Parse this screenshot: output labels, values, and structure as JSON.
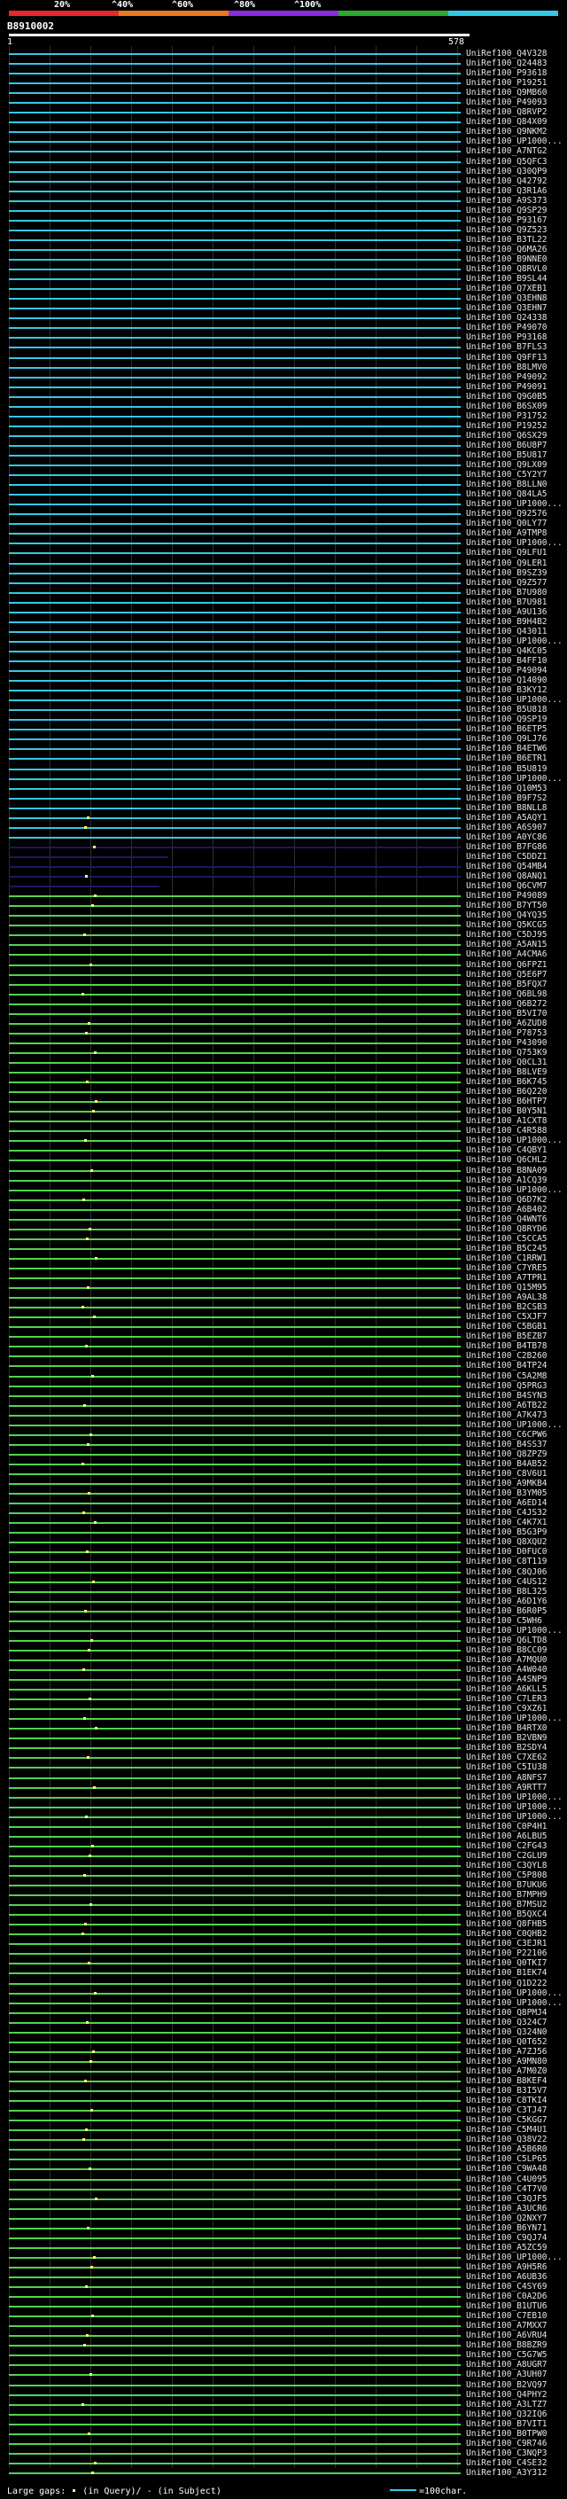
{
  "query_id": "B8910002",
  "scale": {
    "start": "1",
    "end": "578"
  },
  "identity_bar": {
    "labels": [
      "20%",
      "^40%",
      "^60%",
      "^80%",
      "^100%"
    ],
    "colors": [
      "#e8272f",
      "#e87b1e",
      "#8a2be2",
      "#2eaa2e",
      "#33c9e6"
    ]
  },
  "colors": {
    "high": "#33c9e6",
    "mid": "#4fd54f",
    "low": "#1a1a60",
    "gap": "#ffff66",
    "text": "#e6e6e6"
  },
  "legend": {
    "text": "Large gaps:",
    "in_query": "(in Query)/",
    "in_subject": "- (in Subject)",
    "scale": "=100char."
  },
  "subjects": [
    "UniRef100_Q4V328",
    "UniRef100_Q24483",
    "UniRef100_P93618",
    "UniRef100_P19251",
    "UniRef100_Q9MB60",
    "UniRef100_P49093",
    "UniRef100_Q8RVP2",
    "UniRef100_Q84X09",
    "UniRef100_Q9NKM2",
    "UniRef100_UP1000...",
    "UniRef100_A7NTG2",
    "UniRef100_Q5QFC3",
    "UniRef100_Q30QP9",
    "UniRef100_Q42792",
    "UniRef100_Q3R1A6",
    "UniRef100_A9S373",
    "UniRef100_Q9SP29",
    "UniRef100_P93167",
    "UniRef100_Q9Z523",
    "UniRef100_B3TL22",
    "UniRef100_Q6MA26",
    "UniRef100_B9NNE0",
    "UniRef100_Q8RVL0",
    "UniRef100_B9SL44",
    "UniRef100_Q7XEB1",
    "UniRef100_Q3EHN8",
    "UniRef100_Q3EHN7",
    "UniRef100_Q24338",
    "UniRef100_P49070",
    "UniRef100_P93168",
    "UniRef100_B7FLS3",
    "UniRef100_Q9FF13",
    "UniRef100_B8LMV0",
    "UniRef100_P49092",
    "UniRef100_P49091",
    "UniRef100_Q9G0B5",
    "UniRef100_B6SX09",
    "UniRef100_P31752",
    "UniRef100_P19252",
    "UniRef100_Q6SX29",
    "UniRef100_B6U8P7",
    "UniRef100_B5U817",
    "UniRef100_Q9LX09",
    "UniRef100_C5Y2Y7",
    "UniRef100_B8LLN0",
    "UniRef100_Q84LA5",
    "UniRef100_UP1000...",
    "UniRef100_Q92576",
    "UniRef100_Q0LY77",
    "UniRef100_A9TMP8",
    "UniRef100_UP1000...",
    "UniRef100_Q9LFU1",
    "UniRef100_Q9LER1",
    "UniRef100_B9SZ39",
    "UniRef100_Q9Z577",
    "UniRef100_B7U980",
    "UniRef100_B7U981",
    "UniRef100_A9U136",
    "UniRef100_B9H4B2",
    "UniRef100_Q43011",
    "UniRef100_UP1000...",
    "UniRef100_Q4KC05",
    "UniRef100_B4FF10",
    "UniRef100_P49094",
    "UniRef100_Q14090",
    "UniRef100_B3KY12",
    "UniRef100_UP1000...",
    "UniRef100_B5U818",
    "UniRef100_Q9SP19",
    "UniRef100_B6ETP5",
    "UniRef100_Q9LJ76",
    "UniRef100_B4ETW6",
    "UniRef100_B6ETR1",
    "UniRef100_B5U819",
    "UniRef100_UP1000...",
    "UniRef100_Q10M53",
    "UniRef100_B9F7S2",
    "UniRef100_B8NLL8",
    "UniRef100_A5AQY1",
    "UniRef100_A6S907",
    "UniRef100_A0YC86",
    "UniRef100_B7FG86",
    "UniRef100_C5DDZ1",
    "UniRef100_Q54MB4",
    "UniRef100_Q8ANQ1",
    "UniRef100_Q6CVM7",
    "UniRef100_P49089",
    "UniRef100_B7YT50",
    "UniRef100_Q4YQ35",
    "UniRef100_Q5KCG5",
    "UniRef100_C5DJ95",
    "UniRef100_A5AN15",
    "UniRef100_A4CMA6",
    "UniRef100_Q6FPZ1",
    "UniRef100_Q5E6P7",
    "UniRef100_B5FQX7",
    "UniRef100_Q6BL98",
    "UniRef100_Q6B272",
    "UniRef100_B5VI70",
    "UniRef100_A6ZUD8",
    "UniRef100_P78753",
    "UniRef100_P43090",
    "UniRef100_Q753K9",
    "UniRef100_Q0CL31",
    "UniRef100_B8LVE9",
    "UniRef100_B6K745",
    "UniRef100_B6Q220",
    "UniRef100_B6HTP7",
    "UniRef100_B0Y5N1",
    "UniRef100_A1CXT8",
    "UniRef100_C4R588",
    "UniRef100_UP1000...",
    "UniRef100_C4QBY1",
    "UniRef100_Q6CHL2",
    "UniRef100_B8NA09",
    "UniRef100_A1CQ39",
    "UniRef100_UP1000...",
    "UniRef100_Q6D7K2",
    "UniRef100_A6B402",
    "UniRef100_Q4WNT6",
    "UniRef100_Q8RYD6",
    "UniRef100_C5CCA5",
    "UniRef100_B5C245",
    "UniRef100_C1RRW1",
    "UniRef100_C7YRE5",
    "UniRef100_A7TPR1",
    "UniRef100_Q15M95",
    "UniRef100_A9AL38",
    "UniRef100_B2CSB3",
    "UniRef100_C5XJF7",
    "UniRef100_C5BGB1",
    "UniRef100_B5EZB7",
    "UniRef100_B4TB78",
    "UniRef100_C2B260",
    "UniRef100_B4TP24",
    "UniRef100_C5A2M8",
    "UniRef100_Q5PRG3",
    "UniRef100_B4SYN3",
    "UniRef100_A6TB22",
    "UniRef100_A7K473",
    "UniRef100_UP1000...",
    "UniRef100_C6CPW6",
    "UniRef100_B4SS37",
    "UniRef100_Q8ZPZ9",
    "UniRef100_B4AB52",
    "UniRef100_C8V6U1",
    "UniRef100_A9MKB4",
    "UniRef100_B3YM05",
    "UniRef100_A6ED14",
    "UniRef100_C4JS32",
    "UniRef100_C4K7X1",
    "UniRef100_B5G3P9",
    "UniRef100_Q8XQU2",
    "UniRef100_D0FUC0",
    "UniRef100_C8T119",
    "UniRef100_C8QJ06",
    "UniRef100_C4US12",
    "UniRef100_B8L325",
    "UniRef100_A6D1Y6",
    "UniRef100_B6R0P5",
    "UniRef100_C5WH6",
    "UniRef100_UP1000...",
    "UniRef100_Q6LTD8",
    "UniRef100_B8CC09",
    "UniRef100_A7MQU0",
    "UniRef100_A4W040",
    "UniRef100_A4SNP9",
    "UniRef100_A6KLL5",
    "UniRef100_C7LER3",
    "UniRef100_C9XZ61",
    "UniRef100_UP1000...",
    "UniRef100_B4RTX0",
    "UniRef100_B2VBN9",
    "UniRef100_B2SDY4",
    "UniRef100_C7XE62",
    "UniRef100_C5IU38",
    "UniRef100_A8NFS7",
    "UniRef100_A9RTT7",
    "UniRef100_UP1000...",
    "UniRef100_UP1000...",
    "UniRef100_UP1000...",
    "UniRef100_C0P4H1",
    "UniRef100_A6LBU5",
    "UniRef100_C2FG43",
    "UniRef100_C2GLU9",
    "UniRef100_C3QYL8",
    "UniRef100_C5P808",
    "UniRef100_B7UKU6",
    "UniRef100_B7MPH9",
    "UniRef100_B7MSU2",
    "UniRef100_B5QXC4",
    "UniRef100_Q8FHB5",
    "UniRef100_C0QHB2",
    "UniRef100_C3EJR1",
    "UniRef100_P22106",
    "UniRef100_Q0TKI7",
    "UniRef100_B1EK74",
    "UniRef100_Q1D222",
    "UniRef100_UP1000...",
    "UniRef100_UP1000...",
    "UniRef100_Q8PMJ4",
    "UniRef100_Q324C7",
    "UniRef100_Q324N0",
    "UniRef100_Q0T652",
    "UniRef100_A7ZJ56",
    "UniRef100_A9MN80",
    "UniRef100_A7M0Z0",
    "UniRef100_B8KEF4",
    "UniRef100_B3I5V7",
    "UniRef100_C8TKI4",
    "UniRef100_C3TJ47",
    "UniRef100_C5KGG7",
    "UniRef100_C5M4U1",
    "UniRef100_Q38V22",
    "UniRef100_A5B6R0",
    "UniRef100_C5LP65",
    "UniRef100_C9WA48",
    "UniRef100_C4U095",
    "UniRef100_C4T7V0",
    "UniRef100_C3QJF5",
    "UniRef100_A3UCR6",
    "UniRef100_Q2NXY7",
    "UniRef100_B6YN71",
    "UniRef100_C9QJ74",
    "UniRef100_A5ZC59",
    "UniRef100_UP1000...",
    "UniRef100_A9H5R6",
    "UniRef100_A6UB36",
    "UniRef100_C4SY69",
    "UniRef100_C0A2D6",
    "UniRef100_B1UTU6",
    "UniRef100_C7EB10",
    "UniRef100_A7MXX7",
    "UniRef100_A6VRU4",
    "UniRef100_B8BZR9",
    "UniRef100_C5G7W5",
    "UniRef100_A8UGR7",
    "UniRef100_A3UH07",
    "UniRef100_B2VQ97",
    "UniRef100_Q4PHY2",
    "UniRef100_A3LTZ7",
    "UniRef100_Q32IQ6",
    "UniRef100_B7VIT1",
    "UniRef100_B0TPW0",
    "UniRef100_C9R746",
    "UniRef100_C3NQP3",
    "UniRef100_C4SE32",
    "UniRef100_A3Y312"
  ]
}
